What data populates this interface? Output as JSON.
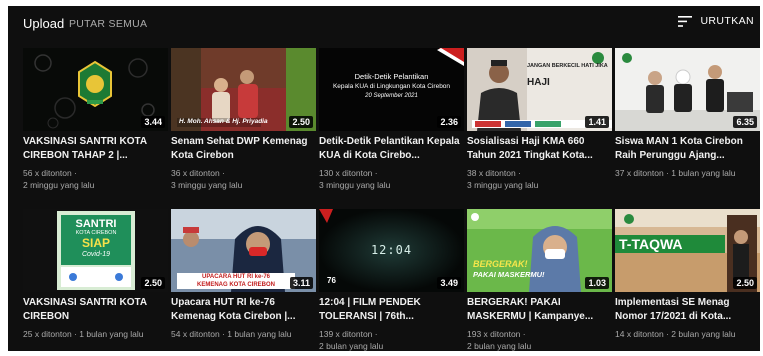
{
  "topbar": {
    "upload": "Upload",
    "play_all": "PUTAR SEMUA",
    "sort": "URUTKAN"
  },
  "videos": [
    {
      "title": "VAKSINASI SANTRI KOTA CIREBON TAHAP 2 |...",
      "views": "56 x ditonton ·",
      "age": "2 minggu yang lalu",
      "duration": "3.44"
    },
    {
      "title": "Senam Sehat DWP Kemenag Kota Cirebon",
      "views": "36 x ditonton ·",
      "age": "3 minggu yang lalu",
      "duration": "2.50",
      "overlay": "H. Moh. Ahsan & Hj. Priyadia"
    },
    {
      "title": "Detik-Detik Pelantikan Kepala KUA di Kota Cirebo...",
      "views": "130 x ditonton ·",
      "age": "3 minggu yang lalu",
      "duration": "2.36",
      "overlay_lines": [
        "Detik-Detik Pelantikan",
        "Kepala KUA di Lingkungan Kota Cirebon",
        "20 September 2021"
      ]
    },
    {
      "title": "Sosialisasi Haji KMA 660 Tahun 2021 Tingkat Kota...",
      "views": "38 x ditonton ·",
      "age": "3 minggu yang lalu",
      "duration": "1.41",
      "overlay_lines": [
        "JANGAN BERKECIL HATI JIKA",
        "HAJI"
      ]
    },
    {
      "title": "Siswa MAN 1 Kota Cirebon Raih Perunggu Ajang...",
      "views": "37 x ditonton ·",
      "age": "1 bulan yang lalu",
      "duration": "6.35",
      "inline": true
    },
    {
      "title": "VAKSINASI SANTRI KOTA CIREBON",
      "views": "25 x ditonton ·",
      "age": "1 bulan yang lalu",
      "duration": "2.50",
      "inline": true,
      "overlay_lines": [
        "SANTRI",
        "KOTA CIREBON",
        "SIAP",
        "Covid-19"
      ]
    },
    {
      "title": "Upacara HUT RI ke-76 Kemenag Kota Cirebon |...",
      "views": "54 x ditonton ·",
      "age": "1 bulan yang lalu",
      "duration": "3.11",
      "inline": true,
      "overlay_lines": [
        "UPACARA HUT RI ke-76",
        "KEMENAG KOTA CIREBON"
      ]
    },
    {
      "title": "12:04 | FILM PENDEK TOLERANSI | 76th...",
      "views": "139 x ditonton ·",
      "age": "2 bulan yang lalu",
      "duration": "3.49",
      "overlay_lines": [
        "12:04"
      ]
    },
    {
      "title": "BERGERAK! PAKAI MASKERMU | Kampanye...",
      "views": "193 x ditonton ·",
      "age": "2 bulan yang lalu",
      "duration": "1.03",
      "overlay_lines": [
        "BERGERAK!",
        "PAKAI MASKERMU!"
      ]
    },
    {
      "title": "Implementasi SE Menag Nomor 17/2021 di Kota...",
      "views": "14 x ditonton ·",
      "age": "2 bulan yang lalu",
      "duration": "2.50",
      "inline": true,
      "overlay_lines": [
        "T-TAQWA"
      ]
    }
  ],
  "colors": {
    "background": "#0f0f0f",
    "meta_text": "#aaaaaa",
    "title_text": "#f1f1f1"
  },
  "icons": {
    "sort": "sort-lines-icon"
  }
}
